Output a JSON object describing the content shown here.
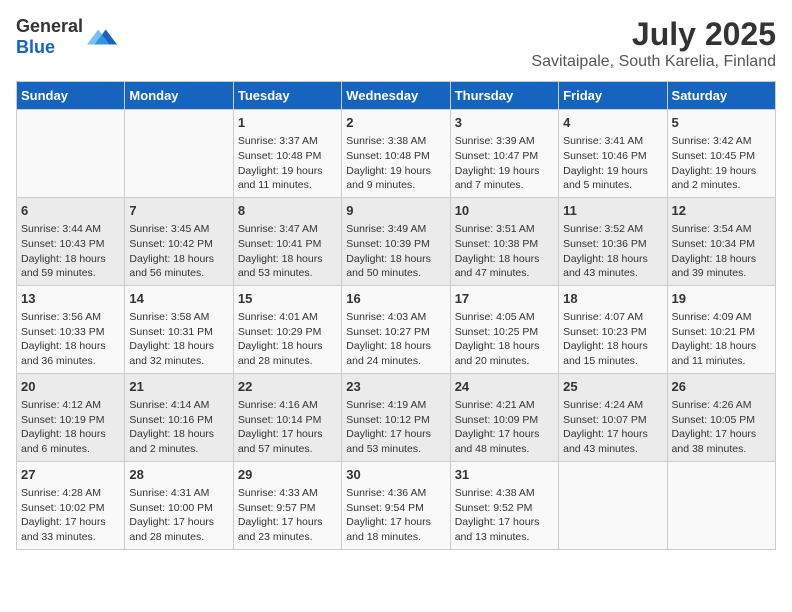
{
  "header": {
    "logo_general": "General",
    "logo_blue": "Blue",
    "title": "July 2025",
    "subtitle": "Savitaipale, South Karelia, Finland"
  },
  "columns": [
    "Sunday",
    "Monday",
    "Tuesday",
    "Wednesday",
    "Thursday",
    "Friday",
    "Saturday"
  ],
  "weeks": [
    [
      {
        "day": "",
        "info": ""
      },
      {
        "day": "",
        "info": ""
      },
      {
        "day": "1",
        "info": "Sunrise: 3:37 AM\nSunset: 10:48 PM\nDaylight: 19 hours and 11 minutes."
      },
      {
        "day": "2",
        "info": "Sunrise: 3:38 AM\nSunset: 10:48 PM\nDaylight: 19 hours and 9 minutes."
      },
      {
        "day": "3",
        "info": "Sunrise: 3:39 AM\nSunset: 10:47 PM\nDaylight: 19 hours and 7 minutes."
      },
      {
        "day": "4",
        "info": "Sunrise: 3:41 AM\nSunset: 10:46 PM\nDaylight: 19 hours and 5 minutes."
      },
      {
        "day": "5",
        "info": "Sunrise: 3:42 AM\nSunset: 10:45 PM\nDaylight: 19 hours and 2 minutes."
      }
    ],
    [
      {
        "day": "6",
        "info": "Sunrise: 3:44 AM\nSunset: 10:43 PM\nDaylight: 18 hours and 59 minutes."
      },
      {
        "day": "7",
        "info": "Sunrise: 3:45 AM\nSunset: 10:42 PM\nDaylight: 18 hours and 56 minutes."
      },
      {
        "day": "8",
        "info": "Sunrise: 3:47 AM\nSunset: 10:41 PM\nDaylight: 18 hours and 53 minutes."
      },
      {
        "day": "9",
        "info": "Sunrise: 3:49 AM\nSunset: 10:39 PM\nDaylight: 18 hours and 50 minutes."
      },
      {
        "day": "10",
        "info": "Sunrise: 3:51 AM\nSunset: 10:38 PM\nDaylight: 18 hours and 47 minutes."
      },
      {
        "day": "11",
        "info": "Sunrise: 3:52 AM\nSunset: 10:36 PM\nDaylight: 18 hours and 43 minutes."
      },
      {
        "day": "12",
        "info": "Sunrise: 3:54 AM\nSunset: 10:34 PM\nDaylight: 18 hours and 39 minutes."
      }
    ],
    [
      {
        "day": "13",
        "info": "Sunrise: 3:56 AM\nSunset: 10:33 PM\nDaylight: 18 hours and 36 minutes."
      },
      {
        "day": "14",
        "info": "Sunrise: 3:58 AM\nSunset: 10:31 PM\nDaylight: 18 hours and 32 minutes."
      },
      {
        "day": "15",
        "info": "Sunrise: 4:01 AM\nSunset: 10:29 PM\nDaylight: 18 hours and 28 minutes."
      },
      {
        "day": "16",
        "info": "Sunrise: 4:03 AM\nSunset: 10:27 PM\nDaylight: 18 hours and 24 minutes."
      },
      {
        "day": "17",
        "info": "Sunrise: 4:05 AM\nSunset: 10:25 PM\nDaylight: 18 hours and 20 minutes."
      },
      {
        "day": "18",
        "info": "Sunrise: 4:07 AM\nSunset: 10:23 PM\nDaylight: 18 hours and 15 minutes."
      },
      {
        "day": "19",
        "info": "Sunrise: 4:09 AM\nSunset: 10:21 PM\nDaylight: 18 hours and 11 minutes."
      }
    ],
    [
      {
        "day": "20",
        "info": "Sunrise: 4:12 AM\nSunset: 10:19 PM\nDaylight: 18 hours and 6 minutes."
      },
      {
        "day": "21",
        "info": "Sunrise: 4:14 AM\nSunset: 10:16 PM\nDaylight: 18 hours and 2 minutes."
      },
      {
        "day": "22",
        "info": "Sunrise: 4:16 AM\nSunset: 10:14 PM\nDaylight: 17 hours and 57 minutes."
      },
      {
        "day": "23",
        "info": "Sunrise: 4:19 AM\nSunset: 10:12 PM\nDaylight: 17 hours and 53 minutes."
      },
      {
        "day": "24",
        "info": "Sunrise: 4:21 AM\nSunset: 10:09 PM\nDaylight: 17 hours and 48 minutes."
      },
      {
        "day": "25",
        "info": "Sunrise: 4:24 AM\nSunset: 10:07 PM\nDaylight: 17 hours and 43 minutes."
      },
      {
        "day": "26",
        "info": "Sunrise: 4:26 AM\nSunset: 10:05 PM\nDaylight: 17 hours and 38 minutes."
      }
    ],
    [
      {
        "day": "27",
        "info": "Sunrise: 4:28 AM\nSunset: 10:02 PM\nDaylight: 17 hours and 33 minutes."
      },
      {
        "day": "28",
        "info": "Sunrise: 4:31 AM\nSunset: 10:00 PM\nDaylight: 17 hours and 28 minutes."
      },
      {
        "day": "29",
        "info": "Sunrise: 4:33 AM\nSunset: 9:57 PM\nDaylight: 17 hours and 23 minutes."
      },
      {
        "day": "30",
        "info": "Sunrise: 4:36 AM\nSunset: 9:54 PM\nDaylight: 17 hours and 18 minutes."
      },
      {
        "day": "31",
        "info": "Sunrise: 4:38 AM\nSunset: 9:52 PM\nDaylight: 17 hours and 13 minutes."
      },
      {
        "day": "",
        "info": ""
      },
      {
        "day": "",
        "info": ""
      }
    ]
  ]
}
